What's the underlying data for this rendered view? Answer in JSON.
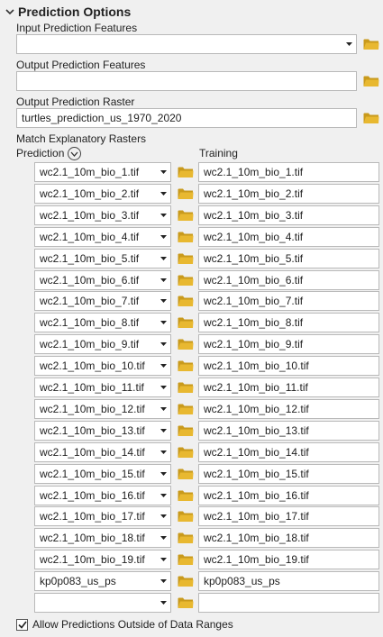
{
  "section": {
    "title": "Prediction Options"
  },
  "input_features": {
    "label": "Input Prediction Features",
    "value": ""
  },
  "output_features": {
    "label": "Output Prediction Features",
    "value": ""
  },
  "output_raster": {
    "label": "Output Prediction Raster",
    "value": "turtles_prediction_us_1970_2020"
  },
  "match": {
    "label": "Match Explanatory Rasters",
    "prediction_header": "Prediction",
    "training_header": "Training",
    "rows": [
      {
        "prediction": "wc2.1_10m_bio_1.tif",
        "training": "wc2.1_10m_bio_1.tif"
      },
      {
        "prediction": "wc2.1_10m_bio_2.tif",
        "training": "wc2.1_10m_bio_2.tif"
      },
      {
        "prediction": "wc2.1_10m_bio_3.tif",
        "training": "wc2.1_10m_bio_3.tif"
      },
      {
        "prediction": "wc2.1_10m_bio_4.tif",
        "training": "wc2.1_10m_bio_4.tif"
      },
      {
        "prediction": "wc2.1_10m_bio_5.tif",
        "training": "wc2.1_10m_bio_5.tif"
      },
      {
        "prediction": "wc2.1_10m_bio_6.tif",
        "training": "wc2.1_10m_bio_6.tif"
      },
      {
        "prediction": "wc2.1_10m_bio_7.tif",
        "training": "wc2.1_10m_bio_7.tif"
      },
      {
        "prediction": "wc2.1_10m_bio_8.tif",
        "training": "wc2.1_10m_bio_8.tif"
      },
      {
        "prediction": "wc2.1_10m_bio_9.tif",
        "training": "wc2.1_10m_bio_9.tif"
      },
      {
        "prediction": "wc2.1_10m_bio_10.tif",
        "training": "wc2.1_10m_bio_10.tif"
      },
      {
        "prediction": "wc2.1_10m_bio_11.tif",
        "training": "wc2.1_10m_bio_11.tif"
      },
      {
        "prediction": "wc2.1_10m_bio_12.tif",
        "training": "wc2.1_10m_bio_12.tif"
      },
      {
        "prediction": "wc2.1_10m_bio_13.tif",
        "training": "wc2.1_10m_bio_13.tif"
      },
      {
        "prediction": "wc2.1_10m_bio_14.tif",
        "training": "wc2.1_10m_bio_14.tif"
      },
      {
        "prediction": "wc2.1_10m_bio_15.tif",
        "training": "wc2.1_10m_bio_15.tif"
      },
      {
        "prediction": "wc2.1_10m_bio_16.tif",
        "training": "wc2.1_10m_bio_16.tif"
      },
      {
        "prediction": "wc2.1_10m_bio_17.tif",
        "training": "wc2.1_10m_bio_17.tif"
      },
      {
        "prediction": "wc2.1_10m_bio_18.tif",
        "training": "wc2.1_10m_bio_18.tif"
      },
      {
        "prediction": "wc2.1_10m_bio_19.tif",
        "training": "wc2.1_10m_bio_19.tif"
      },
      {
        "prediction": "kp0p083_us_ps",
        "training": "kp0p083_us_ps"
      },
      {
        "prediction": "",
        "training": ""
      }
    ]
  },
  "allow_outside": {
    "label": "Allow Predictions Outside of Data Ranges",
    "checked": true
  },
  "colors": {
    "folder": "#e8b830",
    "folder_dark": "#c99a1c",
    "border": "#b9b9b9",
    "background": "#f0f0f0"
  },
  "icons": {
    "collapse": "chevron-down-icon",
    "folder": "folder-icon",
    "dropdown": "dropdown-arrow-icon",
    "expand_circle": "circle-chevron-down-icon"
  }
}
